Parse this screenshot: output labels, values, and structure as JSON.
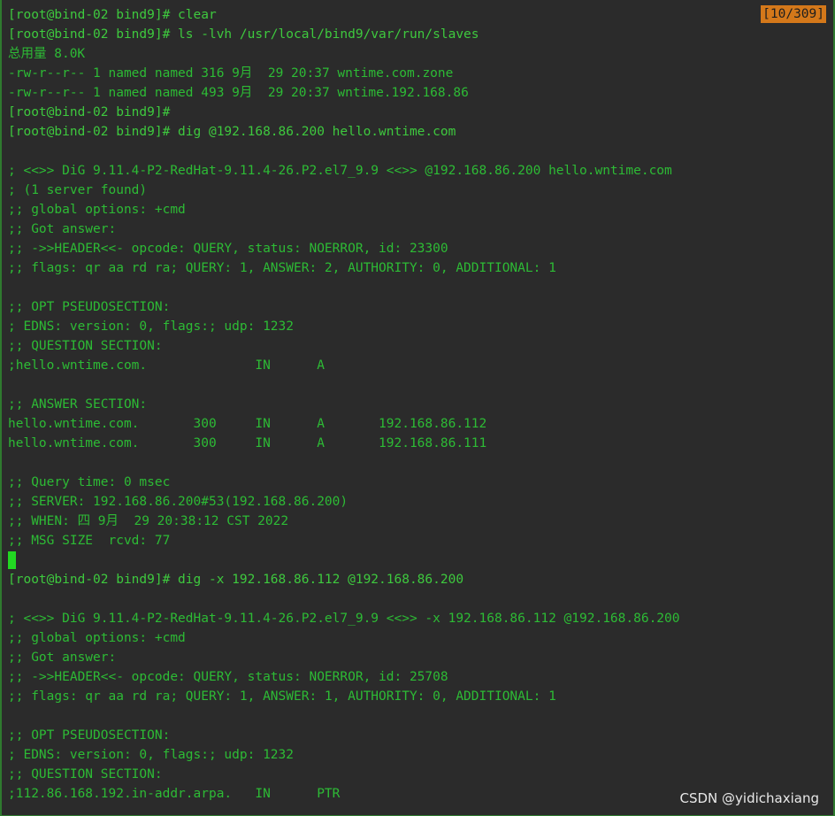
{
  "terminal": {
    "scroll_indicator": "[10/309]",
    "lines": [
      "[root@bind-02 bind9]# clear",
      "[root@bind-02 bind9]# ls -lvh /usr/local/bind9/var/run/slaves",
      "总用量 8.0K",
      "-rw-r--r-- 1 named named 316 9月  29 20:37 wntime.com.zone",
      "-rw-r--r-- 1 named named 493 9月  29 20:37 wntime.192.168.86",
      "[root@bind-02 bind9]#",
      "[root@bind-02 bind9]# dig @192.168.86.200 hello.wntime.com",
      "",
      "; <<>> DiG 9.11.4-P2-RedHat-9.11.4-26.P2.el7_9.9 <<>> @192.168.86.200 hello.wntime.com",
      "; (1 server found)",
      ";; global options: +cmd",
      ";; Got answer:",
      ";; ->>HEADER<<- opcode: QUERY, status: NOERROR, id: 23300",
      ";; flags: qr aa rd ra; QUERY: 1, ANSWER: 2, AUTHORITY: 0, ADDITIONAL: 1",
      "",
      ";; OPT PSEUDOSECTION:",
      "; EDNS: version: 0, flags:; udp: 1232",
      ";; QUESTION SECTION:",
      ";hello.wntime.com.              IN      A",
      "",
      ";; ANSWER SECTION:",
      "hello.wntime.com.       300     IN      A       192.168.86.112",
      "hello.wntime.com.       300     IN      A       192.168.86.111",
      "",
      ";; Query time: 0 msec",
      ";; SERVER: 192.168.86.200#53(192.168.86.200)",
      ";; WHEN: 四 9月  29 20:38:12 CST 2022",
      ";; MSG SIZE  rcvd: 77",
      "",
      "[root@bind-02 bind9]# dig -x 192.168.86.112 @192.168.86.200",
      "",
      "; <<>> DiG 9.11.4-P2-RedHat-9.11.4-26.P2.el7_9.9 <<>> -x 192.168.86.112 @192.168.86.200",
      ";; global options: +cmd",
      ";; Got answer:",
      ";; ->>HEADER<<- opcode: QUERY, status: NOERROR, id: 25708",
      ";; flags: qr aa rd ra; QUERY: 1, ANSWER: 1, AUTHORITY: 0, ADDITIONAL: 1",
      "",
      ";; OPT PSEUDOSECTION:",
      "; EDNS: version: 0, flags:; udp: 1232",
      ";; QUESTION SECTION:",
      ";112.86.168.192.in-addr.arpa.   IN      PTR"
    ]
  },
  "watermark": "CSDN @yidichaxiang",
  "colors": {
    "background": "#2b2b2b",
    "text": "#3ec93e",
    "cursor": "#22d822",
    "indicator": "#d4781a"
  }
}
